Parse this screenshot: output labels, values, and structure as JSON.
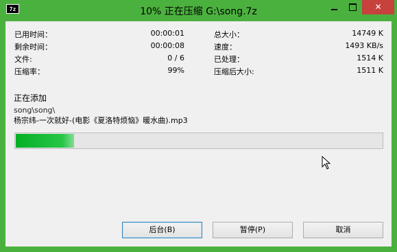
{
  "window": {
    "app_icon_text": "7z",
    "title": "10% 正在压缩 G:\\song.7z",
    "minimize_glyph": "",
    "close_glyph": "✕"
  },
  "stats": {
    "elapsed_label": "已用时间：",
    "elapsed_value": "00:00:01",
    "remaining_label": "剩余时间：",
    "remaining_value": "00:00:08",
    "files_label": "文件:",
    "files_value": "0 / 6",
    "ratio_label": "压缩率：",
    "ratio_value": "99%",
    "total_size_label": "总大小：",
    "total_size_value": "14749 K",
    "speed_label": "速度：",
    "speed_value": "1493 KB/s",
    "processed_label": "已处理：",
    "processed_value": "1514 K",
    "compressed_size_label": "压缩后大小:",
    "compressed_size_value": "1511 K"
  },
  "current": {
    "status": "正在添加",
    "path": "song\\song\\",
    "file": "杨宗纬-一次就好-(电影《夏洛特烦恼》暖水曲).mp3"
  },
  "progress": {
    "percent": 0.16
  },
  "buttons": {
    "background": "后台(B)",
    "pause": "暂停(P)",
    "cancel": "取消"
  }
}
